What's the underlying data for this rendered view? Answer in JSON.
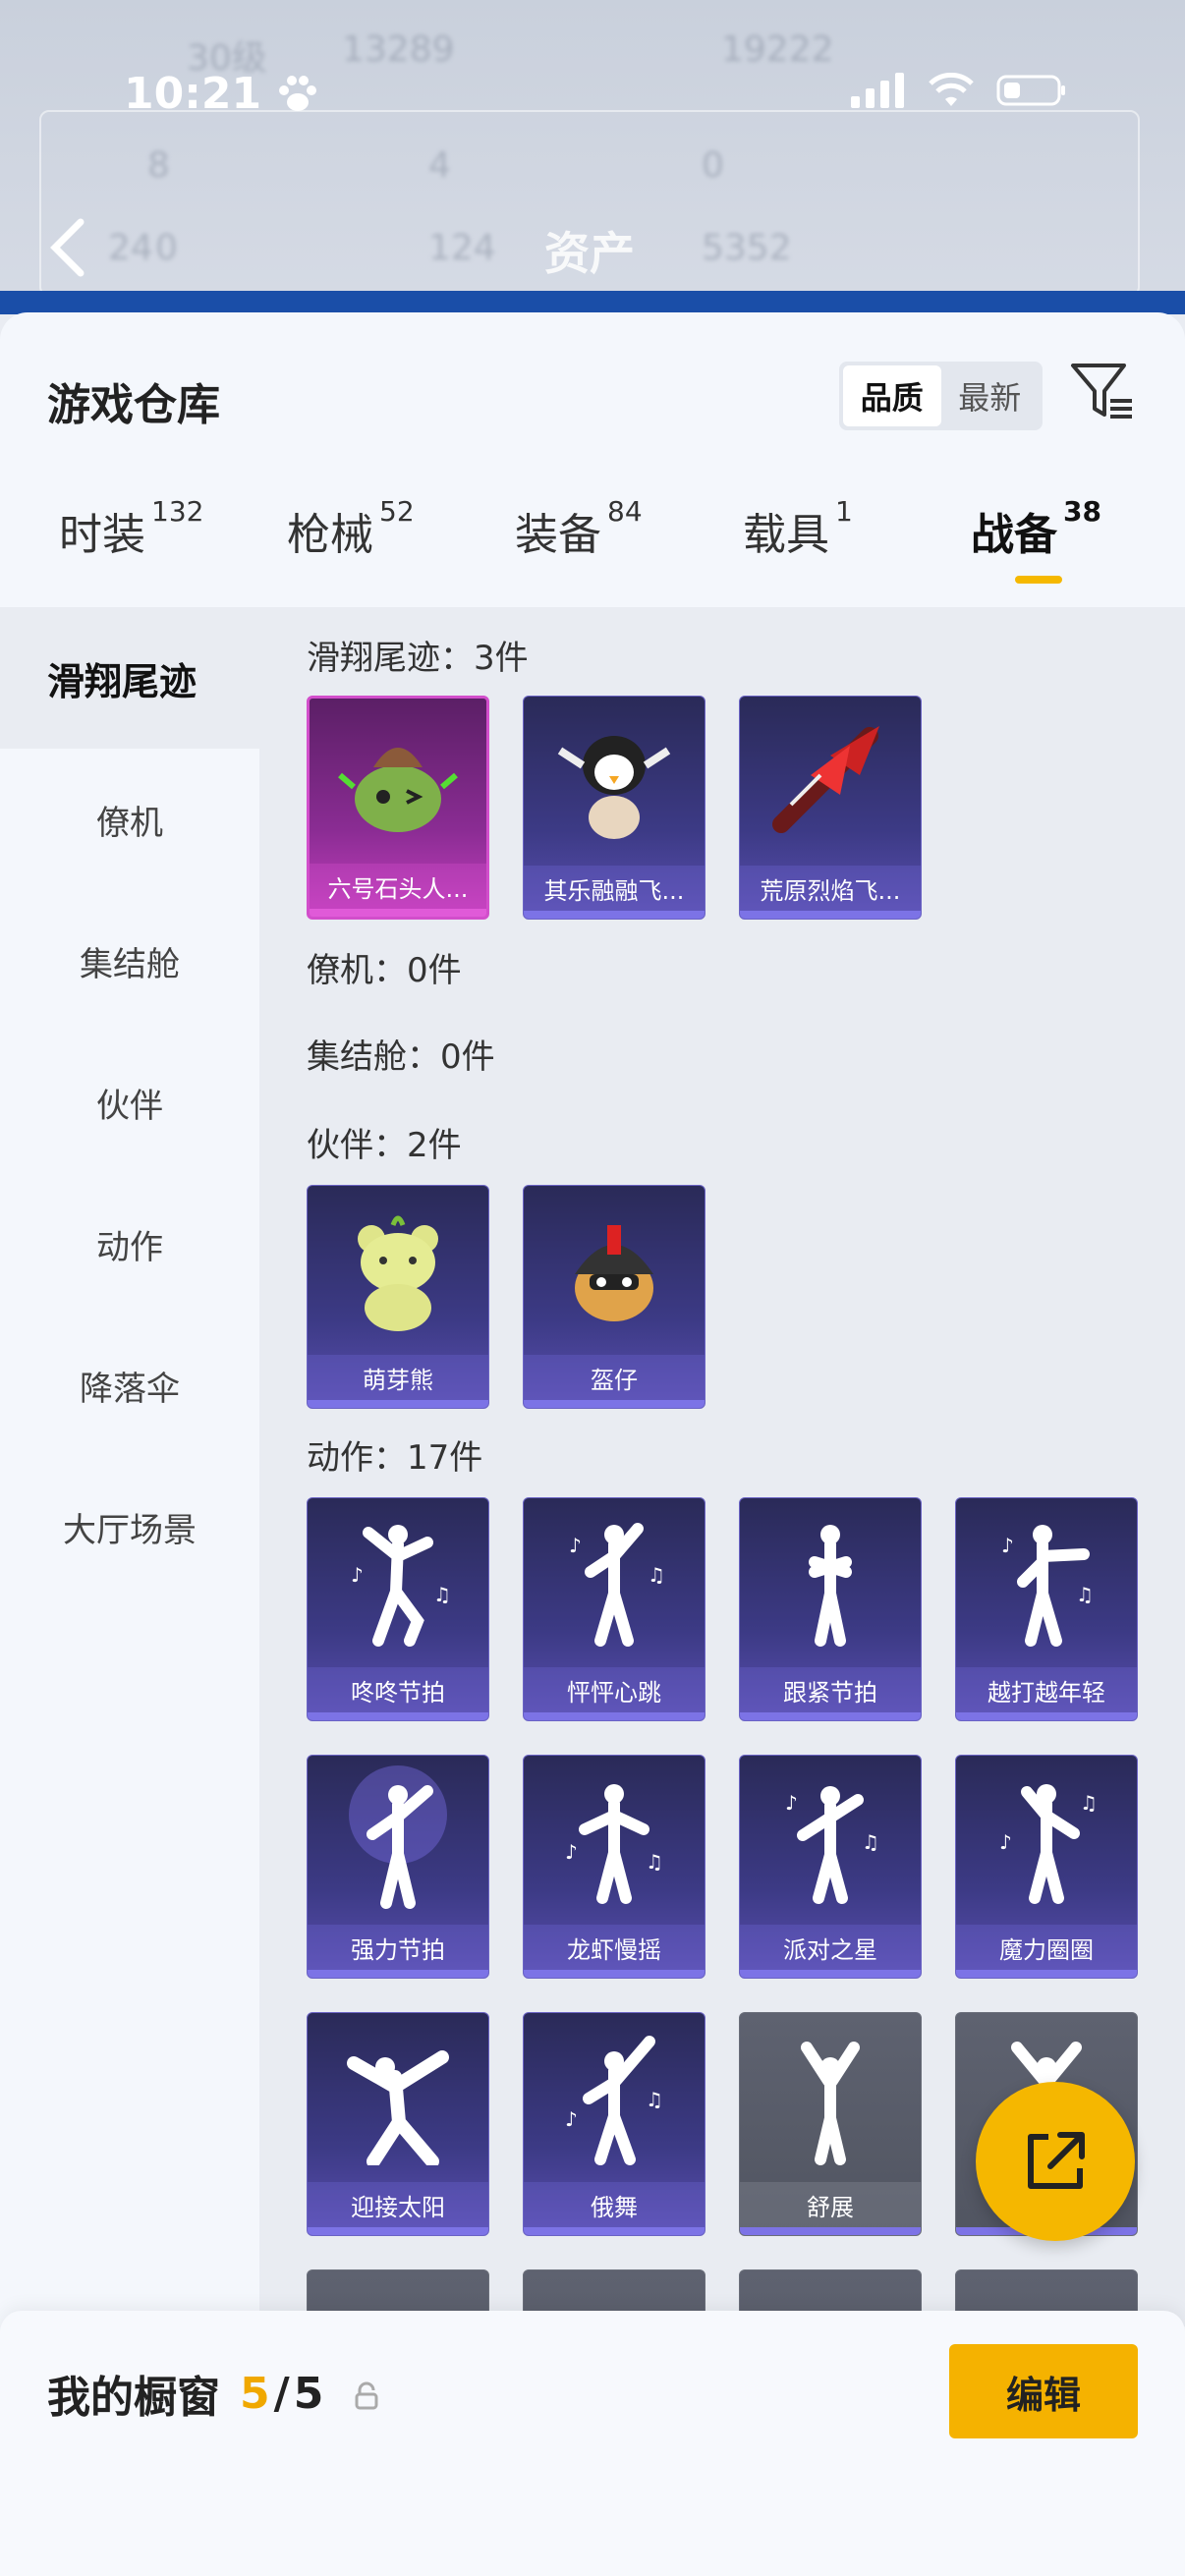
{
  "status_bar": {
    "time": "10:21"
  },
  "background": {
    "level": "30级",
    "n1": "13289",
    "n2": "19222",
    "s1": "8",
    "s2": "4",
    "s3": "0",
    "s4": "24",
    "s5": "0",
    "s6": "124",
    "s7": "5352",
    "assets_label": "资产"
  },
  "header": {
    "title": "游戏仓库",
    "sort_quality": "品质",
    "sort_newest": "最新"
  },
  "tabs": [
    {
      "label": "时装",
      "count": "132"
    },
    {
      "label": "枪械",
      "count": "52"
    },
    {
      "label": "装备",
      "count": "84"
    },
    {
      "label": "载具",
      "count": "1"
    },
    {
      "label": "战备",
      "count": "38"
    }
  ],
  "sidebar": [
    "滑翔尾迹",
    "僚机",
    "集结舱",
    "伙伴",
    "动作",
    "降落伞",
    "大厅场景"
  ],
  "sections": [
    {
      "title": "滑翔尾迹：3件",
      "items": [
        "六号石头人...",
        "其乐融融飞...",
        "荒原烈焰飞..."
      ]
    },
    {
      "title": "僚机：0件"
    },
    {
      "title": "集结舱：0件"
    },
    {
      "title": "伙伴：2件",
      "items": [
        "萌芽熊",
        "盔仔"
      ]
    },
    {
      "title": "动作：17件",
      "items": [
        "咚咚节拍",
        "怦怦心跳",
        "跟紧节拍",
        "越打越年轻",
        "强力节拍",
        "龙虾慢摇",
        "派对之星",
        "魔力圈圈",
        "迎接太阳",
        "俄舞",
        "舒展"
      ]
    }
  ],
  "footer": {
    "title": "我的橱窗",
    "count_current": "5",
    "sep": "/",
    "count_total": "5",
    "edit_label": "编辑"
  },
  "colors": {
    "accent": "#f5b200",
    "tile_blue": "#3c3a85",
    "tile_pink": "#c43fbe"
  }
}
